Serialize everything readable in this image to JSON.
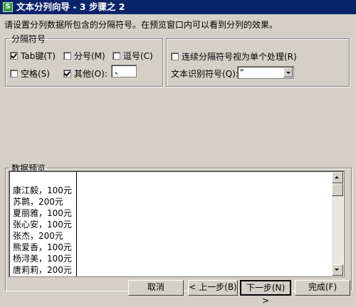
{
  "window": {
    "title": "文本分列向导 - 3 步骤之 2",
    "icon_letter": "S"
  },
  "instruction": "请设置分列数据所包含的分隔符号。在预览窗口内可以看到分列的效果。",
  "separators": {
    "legend": "分隔符号",
    "tab": {
      "label": "Tab键(T)",
      "checked": true
    },
    "semicolon": {
      "label": "分号(M)",
      "checked": false
    },
    "comma": {
      "label": "逗号(C)",
      "checked": false
    },
    "space": {
      "label": "空格(S)",
      "checked": false
    },
    "other": {
      "label": "其他(O):",
      "checked": true,
      "value": "、"
    }
  },
  "options": {
    "consecutive": {
      "label": "连续分隔符号视为单个处理(R)",
      "checked": false
    },
    "qualifier_label": "文本识别符号(Q):",
    "qualifier_value": "\""
  },
  "preview": {
    "legend": "数据预览",
    "rows": [
      "康江毅，100元",
      "苏鹮，200元",
      "夏丽雅，100元",
      "张心安，100元",
      "张杰，200元",
      "熊爱香，100元",
      "杨浔美，100元",
      "唐莉莉，200元"
    ]
  },
  "buttons": {
    "cancel": "取消",
    "back": "< 上一步(B)",
    "next": "下一步(N) >",
    "finish": "完成(F)"
  }
}
